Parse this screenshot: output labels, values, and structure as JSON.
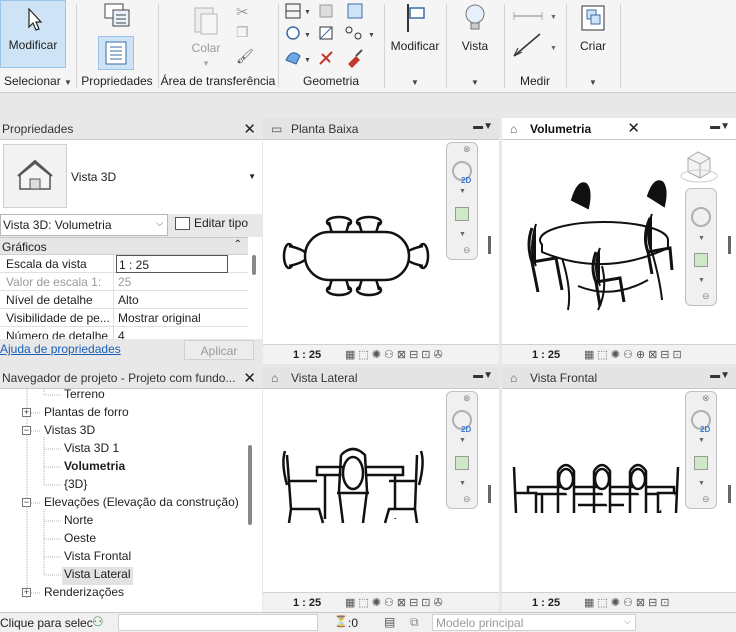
{
  "ribbon": {
    "modify_btn": "Modificar",
    "select_panel": "Selecionar",
    "properties_btn": "Propriedades",
    "paste_btn": "Colar",
    "clipboard_panel": "Área de transferência",
    "geometry_panel": "Geometria",
    "modify_panel": "Modificar",
    "view_panel": "Vista",
    "measure_panel": "Medir",
    "create_panel": "Criar"
  },
  "properties": {
    "title": "Propriedades",
    "type_name": "Vista 3D",
    "view_selector": "Vista 3D: Volumetria",
    "edit_type": "Editar tipo",
    "category": "Gráficos",
    "rows": [
      {
        "key": "Escala da vista",
        "value": "1 : 25"
      },
      {
        "key": "Valor de escala    1:",
        "value": "25"
      },
      {
        "key": "Nível de detalhe",
        "value": "Alto"
      },
      {
        "key": "Visibilidade de pe...",
        "value": "Mostrar original"
      },
      {
        "key": "Número de detalhe",
        "value": "4"
      }
    ],
    "help_link": "Ajuda de propriedades",
    "apply_btn": "Aplicar"
  },
  "navigator": {
    "title": "Navegador de projeto - Projeto com fundo...",
    "items": [
      {
        "label": "Terreno"
      },
      {
        "label": "Plantas de forro"
      },
      {
        "label": "Vistas 3D"
      },
      {
        "label": "Vista 3D 1"
      },
      {
        "label": "Volumetria"
      },
      {
        "label": "{3D}"
      },
      {
        "label": "Elevações (Elevação da construção)"
      },
      {
        "label": "Norte"
      },
      {
        "label": "Oeste"
      },
      {
        "label": "Vista Frontal"
      },
      {
        "label": "Vista Lateral"
      },
      {
        "label": "Renderizações"
      }
    ]
  },
  "views": {
    "planta": {
      "title": "Planta Baixa",
      "scale": "1 : 25"
    },
    "volumetria": {
      "title": "Volumetria",
      "scale": "1 : 25"
    },
    "lateral": {
      "title": "Vista Lateral",
      "scale": "1 : 25"
    },
    "frontal": {
      "title": "Vista Frontal",
      "scale": "1 : 25"
    },
    "nav_2d": "2D"
  },
  "statusbar": {
    "message": "Clique para selec",
    "filter_count": ":0",
    "model": "Modelo principal"
  }
}
